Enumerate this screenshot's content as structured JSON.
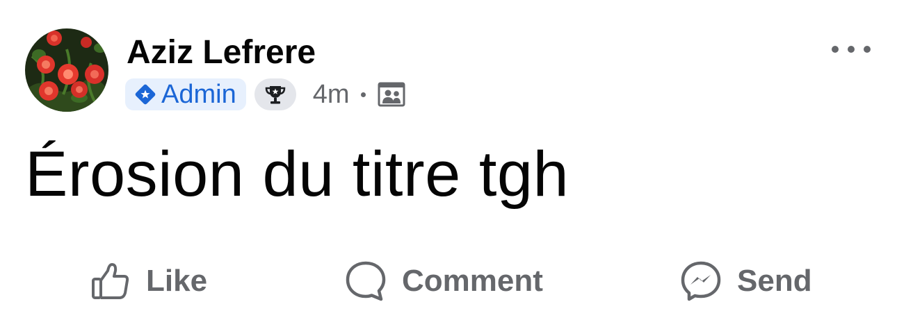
{
  "post": {
    "author": {
      "name": "Aziz Lefrere",
      "avatar": "red-flowers-photo"
    },
    "badges": {
      "role_label": "Admin",
      "role_icon": "blue-diamond-star-icon",
      "achievement_icon": "trophy-icon"
    },
    "time": "4m",
    "audience_icon": "group-members-icon",
    "menu_icon": "more-options-icon",
    "text": "Érosion du titre tgh"
  },
  "actions": {
    "like": {
      "label": "Like",
      "icon": "thumbs-up-icon"
    },
    "comment": {
      "label": "Comment",
      "icon": "speech-bubble-icon"
    },
    "send": {
      "label": "Send",
      "icon": "messenger-icon"
    }
  },
  "colors": {
    "text_primary": "#050505",
    "text_secondary": "#65676b",
    "admin_blue": "#1b66d6",
    "admin_badge_bg": "#e7f0fd",
    "trophy_badge_bg": "#e4e6eb"
  }
}
